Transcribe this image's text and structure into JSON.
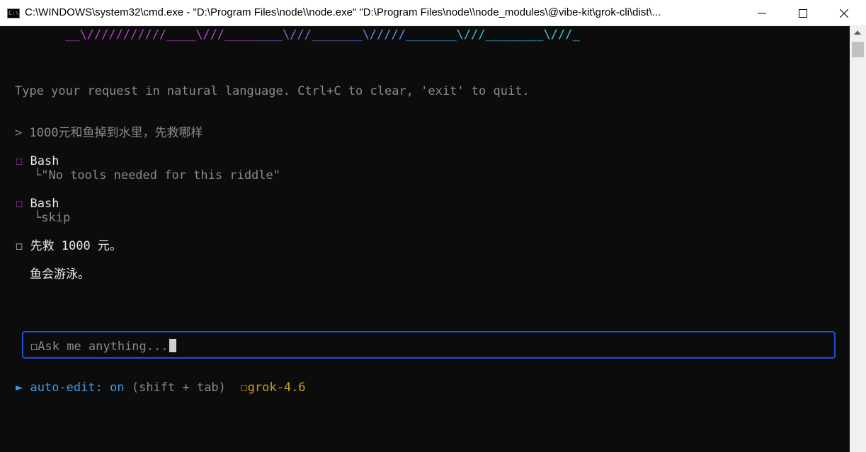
{
  "window": {
    "title": "C:\\WINDOWS\\system32\\cmd.exe  - \"D:\\Program Files\\node\\\\node.exe\"   \"D:\\Program Files\\node\\\\node_modules\\@vibe-kit\\grok-cli\\dist\\...",
    "icon_label": "C:\\"
  },
  "console": {
    "banner": "__\\///////////____\\///________\\///_______\\/////_______\\///________\\///_",
    "hint": "Type your request in natural language. Ctrl+C to clear, 'exit' to quit.",
    "prompt_marker": ">",
    "user_query": "1000元和鱼掉到水里，先救哪样",
    "tool_calls": [
      {
        "box": "☐",
        "name": "Bash",
        "branch": "└",
        "detail": "\"No tools needed for this riddle\""
      },
      {
        "box": "☐",
        "name": "Bash",
        "branch": "└",
        "detail": "skip"
      }
    ],
    "answer_box": "☐",
    "answer_line1": "先救 1000 元。",
    "answer_line2": "鱼会游泳。"
  },
  "input": {
    "box": "☐",
    "placeholder": "Ask me anything..."
  },
  "status": {
    "arrow": "►",
    "mode_label": "auto-edit:",
    "mode_value": "on",
    "shortcut": "(shift + tab)",
    "model_box": "☐",
    "model": "grok-4.6"
  },
  "colors": {
    "background": "#0c0c0c",
    "input_border": "#1f4fd6",
    "status_blue": "#3d9be9",
    "model_orange": "#c8a020",
    "tool_box": "#b432c8"
  },
  "icons": {
    "window_icon": "cmd-icon",
    "minimize": "minimize-icon",
    "maximize": "maximize-icon",
    "close": "close-icon"
  }
}
